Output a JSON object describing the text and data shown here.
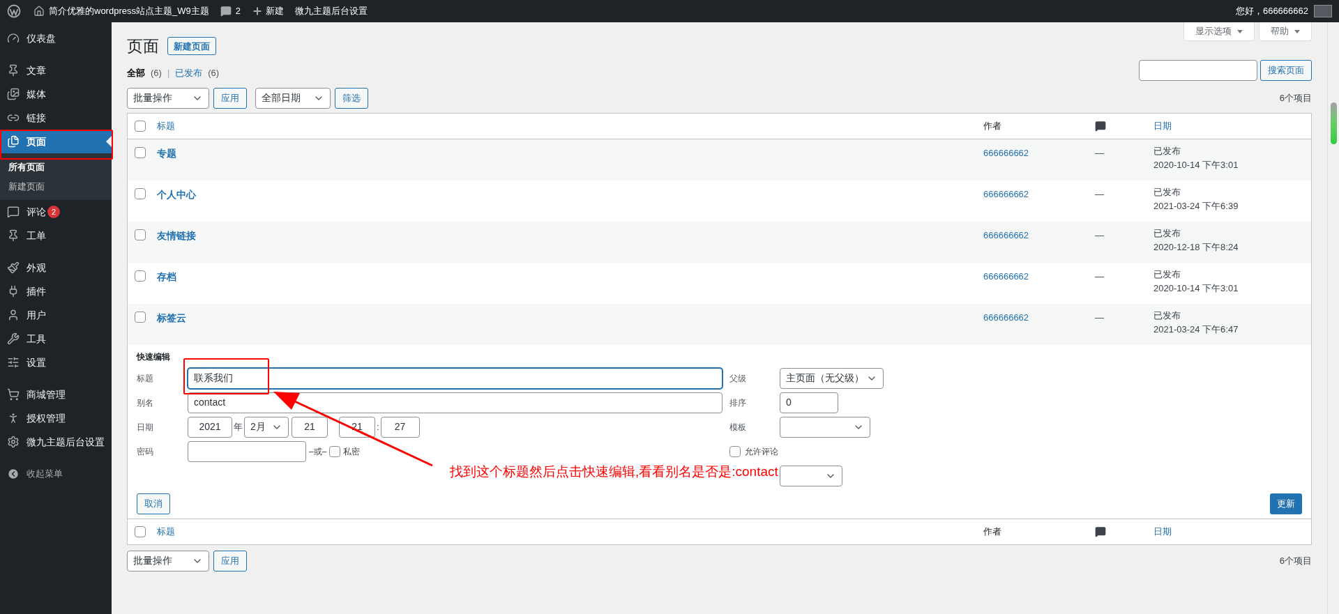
{
  "top_bar": {
    "site_name": "简介优雅的wordpress站点主题_W9主题",
    "comments": "2",
    "new": "新建",
    "theme_settings": "微九主题后台设置",
    "greeting": "您好，666666662"
  },
  "sidebar": {
    "groups": [
      [
        {
          "label": "仪表盘",
          "selected": false
        }
      ],
      [
        {
          "label": "文章",
          "selected": false
        },
        {
          "label": "媒体",
          "selected": false
        },
        {
          "label": "链接",
          "selected": false
        },
        {
          "label": "页面",
          "selected": true,
          "children": [
            {
              "label": "所有页面",
              "selected": true
            },
            {
              "label": "新建页面",
              "selected": false
            }
          ]
        },
        {
          "label": "评论",
          "selected": false,
          "badge": "2"
        },
        {
          "label": "工单",
          "selected": false
        }
      ],
      [
        {
          "label": "外观",
          "selected": false
        },
        {
          "label": "插件",
          "selected": false
        },
        {
          "label": "用户",
          "selected": false
        },
        {
          "label": "工具",
          "selected": false
        },
        {
          "label": "设置",
          "selected": false
        }
      ],
      [
        {
          "label": "商城管理",
          "selected": false
        },
        {
          "label": "授权管理",
          "selected": false
        },
        {
          "label": "微九主题后台设置",
          "selected": false
        }
      ]
    ],
    "collapse": "收起菜单"
  },
  "screen_meta": {
    "screen_options": "显示选项",
    "help": "帮助"
  },
  "page": {
    "title": "页面",
    "add_new": "新建页面"
  },
  "views": [
    {
      "label": "全部",
      "count": "(6)",
      "selected": true
    },
    {
      "label": "已发布",
      "count": "(6)",
      "selected": false
    }
  ],
  "views_separator": "|",
  "search": {
    "button": "搜索页面"
  },
  "tablenav_top": {
    "bulk_action": "批量操作",
    "apply": "应用",
    "date_filter": "全部日期",
    "filter": "筛选",
    "count": "6个项目"
  },
  "table": {
    "header_top": {
      "title": "标题",
      "author": "作者",
      "date": "日期",
      "checked": false
    },
    "header_bottom": {
      "title": "标题",
      "author": "作者",
      "date": "日期",
      "checked": false
    },
    "rows": [
      {
        "title": "专题",
        "author": "666666662",
        "comments": "—",
        "status": "已发布",
        "date": "2020-10-14 下午3:01",
        "checked": false
      },
      {
        "title": "个人中心",
        "author": "666666662",
        "comments": "—",
        "status": "已发布",
        "date": "2021-03-24 下午6:39",
        "checked": false
      },
      {
        "title": "友情链接",
        "author": "666666662",
        "comments": "—",
        "status": "已发布",
        "date": "2020-12-18 下午8:24",
        "checked": false
      },
      {
        "title": "存档",
        "author": "666666662",
        "comments": "—",
        "status": "已发布",
        "date": "2020-10-14 下午3:01",
        "checked": false
      },
      {
        "title": "标签云",
        "author": "666666662",
        "comments": "—",
        "status": "已发布",
        "date": "2021-03-24 下午6:47",
        "checked": false
      }
    ]
  },
  "quick_edit": {
    "heading": "快速编辑",
    "title_label": "标题",
    "title_value": "联系我们",
    "title_focused": true,
    "slug_label": "别名",
    "slug_value": "contact",
    "date_label": "日期",
    "year": "2021",
    "year_unit": "年",
    "month": "2月",
    "day": "21",
    "hour": "21",
    "time_separator": ":",
    "minute": "27",
    "password_label": "密码",
    "or_text": "–或–",
    "private_label": "私密",
    "private_checked": false,
    "parent_label": "父级",
    "parent_value": "主页面（无父级）",
    "order_label": "排序",
    "order_value": "0",
    "template_label": "模板",
    "allow_comments_label": "允许评论",
    "allow_comments_checked": false,
    "cancel": "取消",
    "update": "更新"
  },
  "tablenav_bottom": {
    "bulk_action": "批量操作",
    "apply": "应用",
    "count": "6个项目"
  },
  "annotation": {
    "text": "找到这个标题然后点击快速编辑,看看别名是否是:contact"
  }
}
